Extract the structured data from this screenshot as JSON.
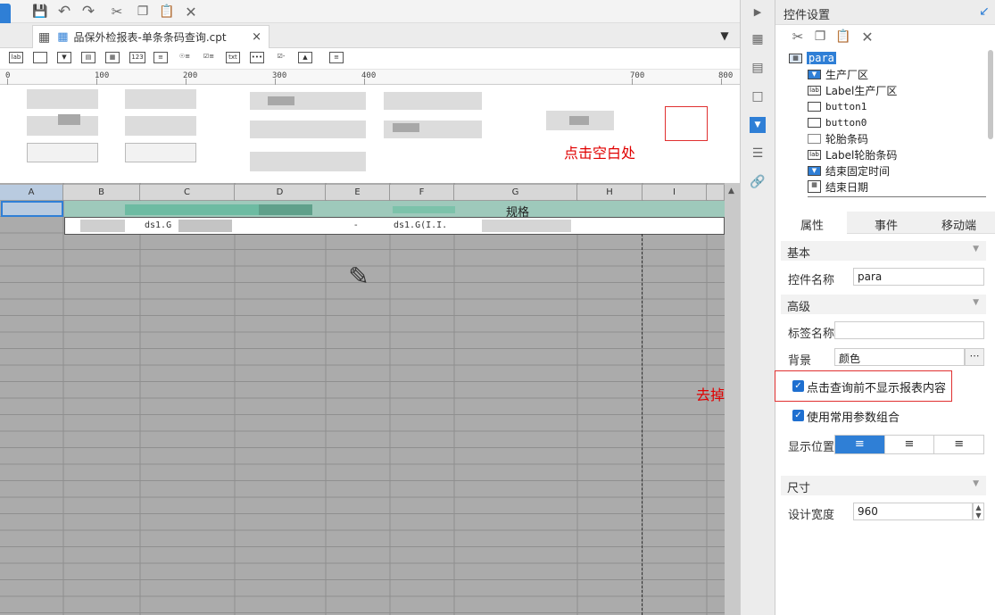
{
  "tab": {
    "title": "品保外检报表-单条条码查询.cpt",
    "close": "×"
  },
  "ruler": [
    "0",
    "100",
    "200",
    "300",
    "400",
    "700",
    "800"
  ],
  "columns": [
    "A",
    "B",
    "C",
    "D",
    "E",
    "F",
    "G",
    "H",
    "I"
  ],
  "cells": {
    "g1": "规格",
    "c2": "ds1.G",
    "f2": "ds1.G(I.I.",
    "e2": "-"
  },
  "annotations": {
    "blank_click": "点击空白处",
    "remove": "去掉"
  },
  "panel": {
    "title": "控件设置",
    "tree": [
      {
        "label": "para",
        "selected": true
      },
      {
        "label": "生产厂区"
      },
      {
        "label": "Label生产厂区"
      },
      {
        "label": "button1"
      },
      {
        "label": "button0"
      },
      {
        "label": "轮胎条码"
      },
      {
        "label": "Label轮胎条码"
      },
      {
        "label": "结束固定时间"
      },
      {
        "label": "结束日期"
      }
    ],
    "tabs": [
      "属性",
      "事件",
      "移动端"
    ],
    "sections": {
      "basic": "基本",
      "advanced": "高级",
      "size": "尺寸"
    },
    "fields": {
      "name_label": "控件名称",
      "name_value": "para",
      "tag_label": "标签名称",
      "tag_value": "",
      "bg_label": "背景",
      "bg_value": "颜色",
      "chk1": "点击查询前不显示报表内容",
      "chk2": "使用常用参数组合",
      "align_label": "显示位置",
      "width_label": "设计宽度",
      "width_value": "960"
    }
  },
  "colors": {
    "accent": "#1e6fd0",
    "highlight_box": "#e03030",
    "note_text": "#e00000"
  }
}
